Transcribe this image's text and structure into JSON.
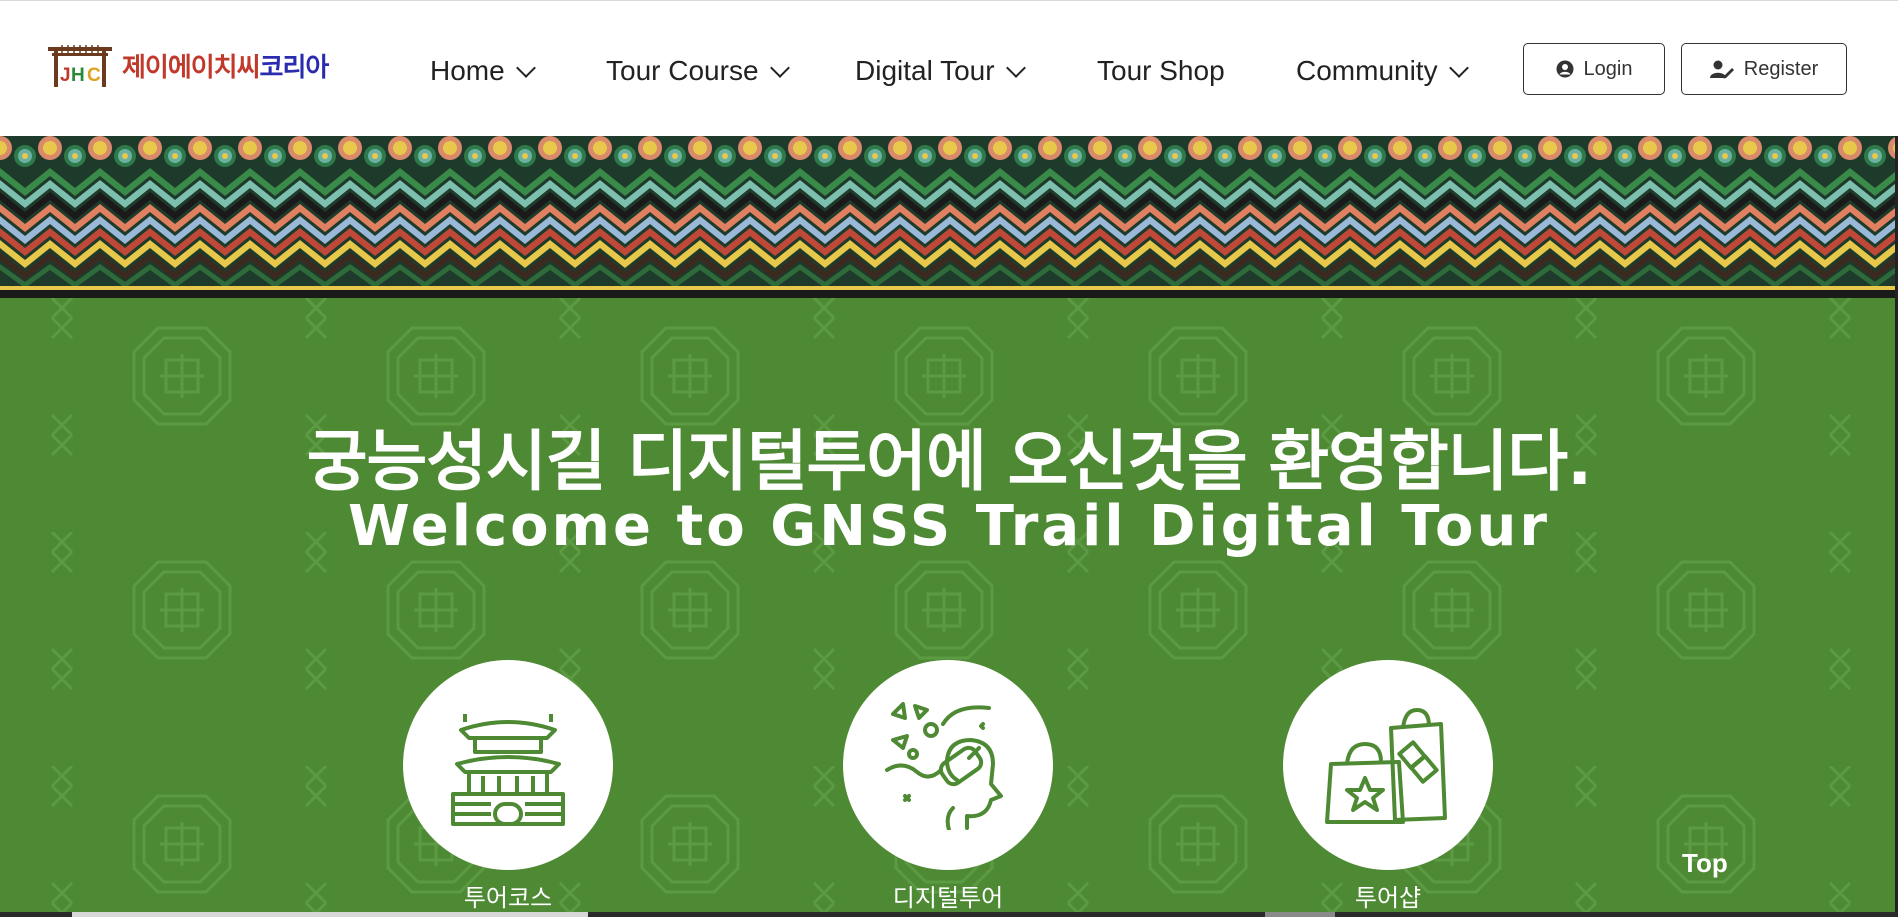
{
  "logo": {
    "alt_text": "JHC",
    "name_part1": "제이에이치씨",
    "name_part2": "코리아"
  },
  "nav": {
    "items": [
      {
        "label": "Home",
        "has_dropdown": true
      },
      {
        "label": "Tour Course",
        "has_dropdown": true
      },
      {
        "label": "Digital Tour",
        "has_dropdown": true
      },
      {
        "label": "Tour Shop",
        "has_dropdown": false
      },
      {
        "label": "Community",
        "has_dropdown": true
      }
    ]
  },
  "auth": {
    "login_label": "Login",
    "register_label": "Register"
  },
  "hero": {
    "title_ko": "궁능성시길 디지털투어에 오신것을 환영합니다.",
    "title_en": "Welcome to GNSS Trail Digital Tour",
    "cards": [
      {
        "label": "투어코스",
        "icon": "palace-icon"
      },
      {
        "label": "디지털투어",
        "icon": "vr-headset-icon"
      },
      {
        "label": "투어샵",
        "icon": "shopping-bags-icon"
      }
    ],
    "top_button": "Top"
  },
  "colors": {
    "hero_green": "#4e8a34",
    "icon_green": "#4e8a34",
    "logo_red": "#c0392b",
    "logo_blue": "#2b2bb0"
  }
}
